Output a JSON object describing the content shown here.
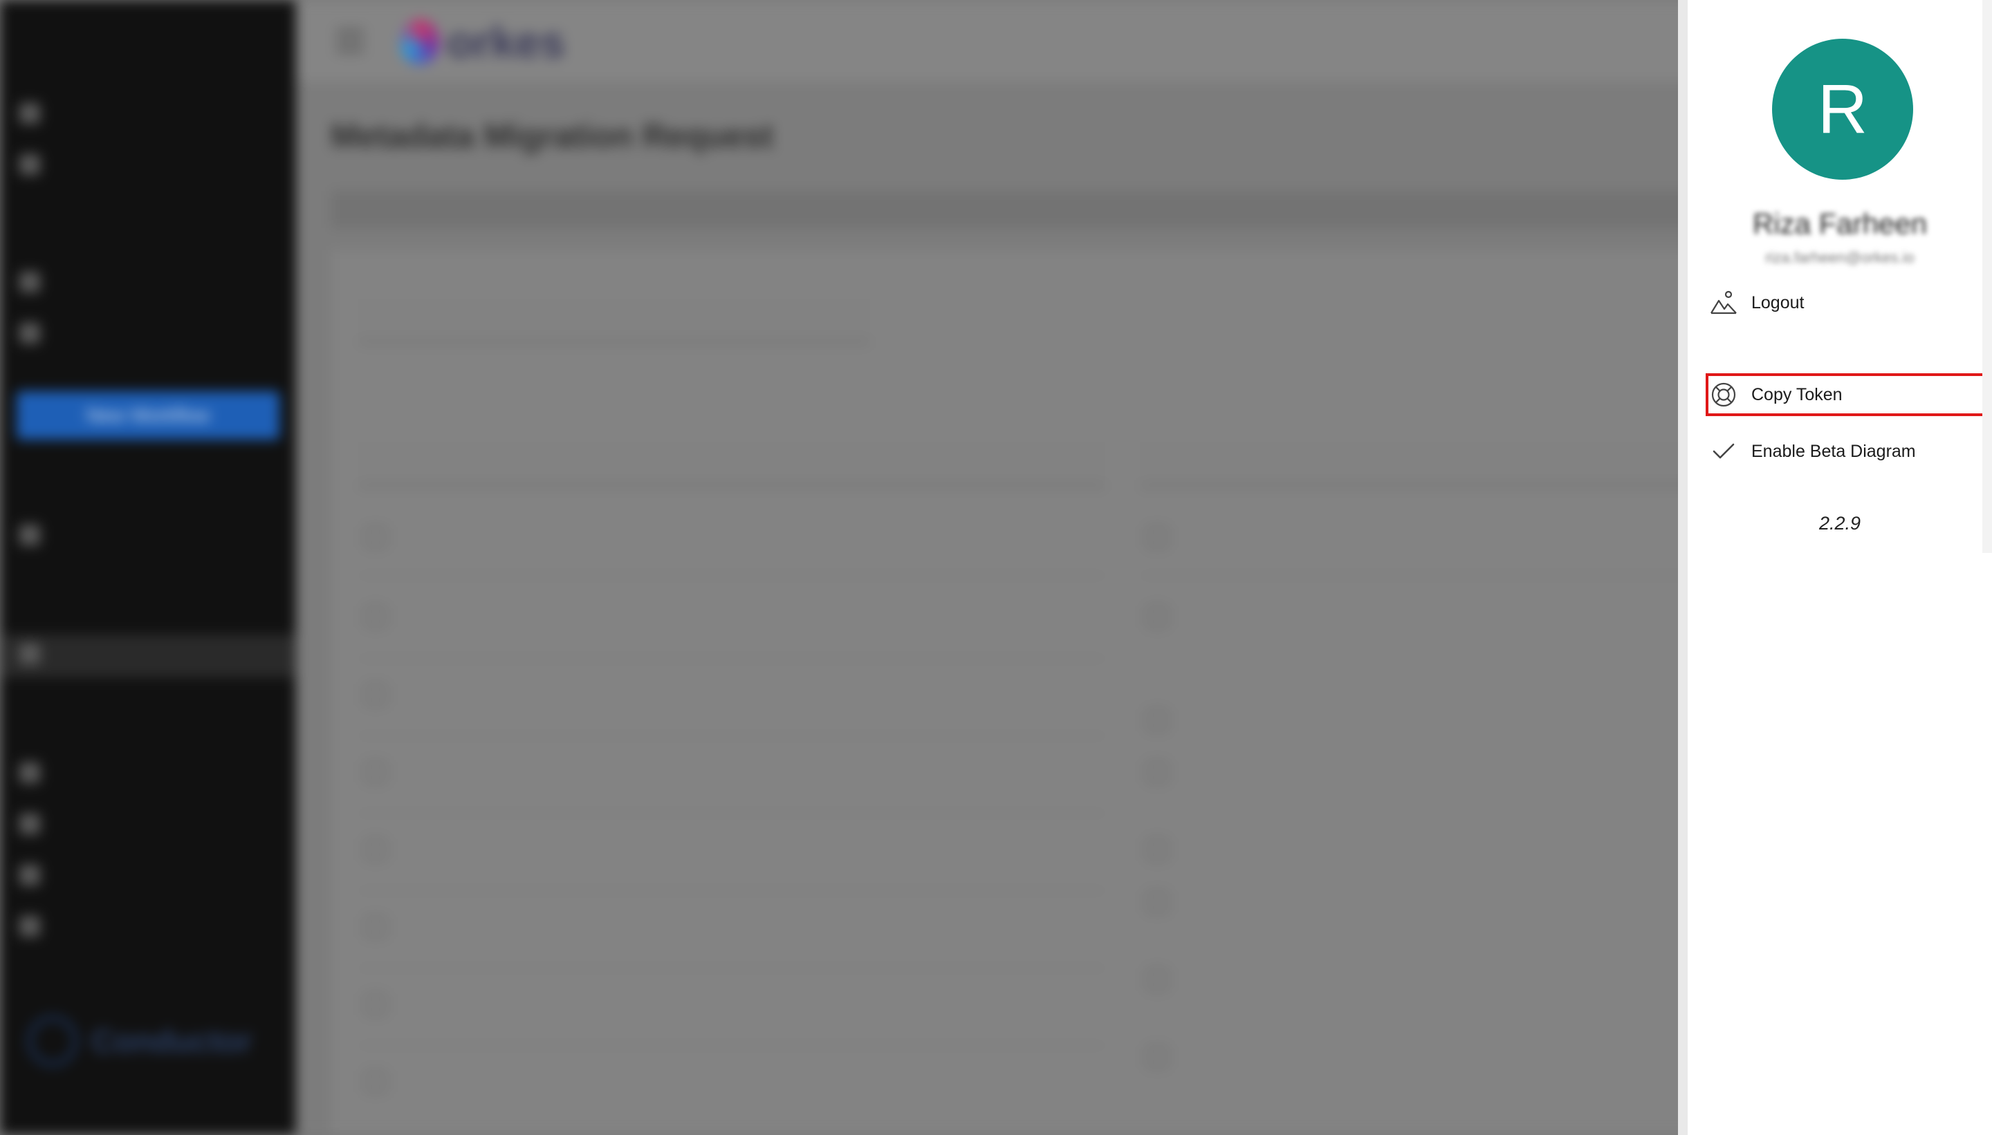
{
  "user_menu": {
    "avatar_initial": "R",
    "avatar_color": "#169386",
    "user_name": "Riza Farheen",
    "user_email": "riza.farheen@orkes.io",
    "items": [
      {
        "label": "Logout",
        "icon": "mountain-person-icon"
      },
      {
        "label": "Copy Token",
        "icon": "lifebuoy-icon",
        "highlighted": true
      },
      {
        "label": "Enable Beta Diagram",
        "icon": "check-icon"
      }
    ],
    "version": "2.2.9",
    "highlight_color": "#e01818"
  },
  "background": {
    "brand": "orkes",
    "page_title": "Metadata Migration Request",
    "sidebar": {
      "new_button": "New Workflow",
      "footer_brand": "Conductor"
    }
  }
}
